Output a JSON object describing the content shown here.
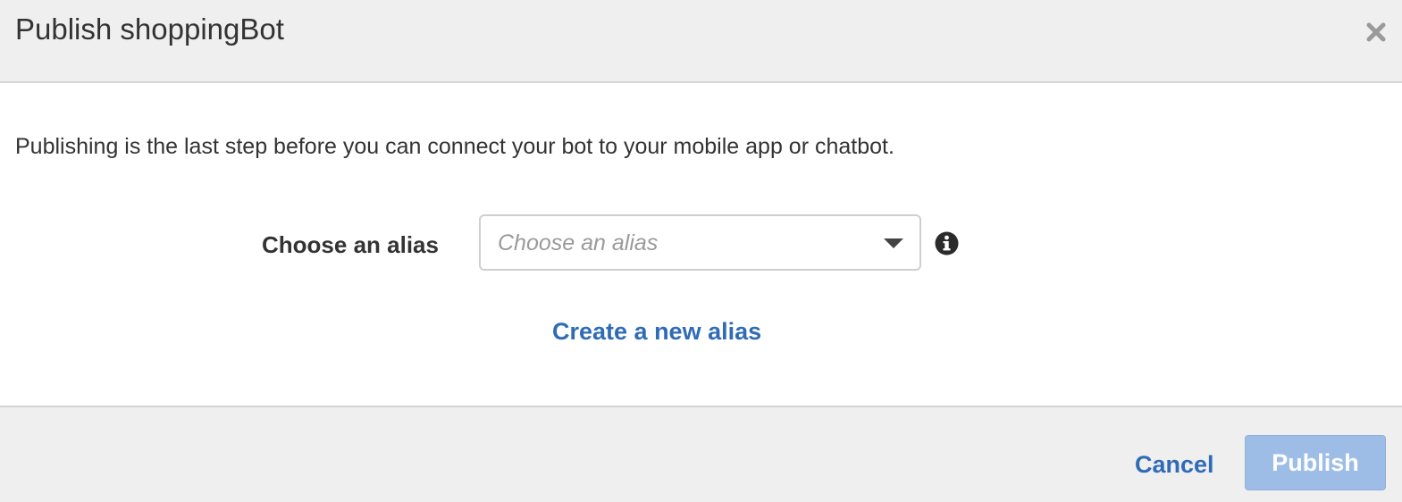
{
  "dialog": {
    "title": "Publish shoppingBot",
    "close_icon": "close-icon",
    "description": "Publishing is the last step before you can connect your bot to your mobile app or chatbot."
  },
  "alias": {
    "label": "Choose an alias",
    "placeholder": "Choose an alias",
    "selected_value": "",
    "dropdown_icon": "chevron-down-icon",
    "info_icon": "info-icon",
    "create_link": "Create a new alias"
  },
  "footer": {
    "cancel_label": "Cancel",
    "publish_label": "Publish",
    "publish_enabled": false
  },
  "colors": {
    "header_bg": "#efefef",
    "link_blue": "#2f6bb7",
    "publish_disabled_bg": "#9ebde6",
    "text": "#333333",
    "placeholder": "#9a9a9a"
  }
}
